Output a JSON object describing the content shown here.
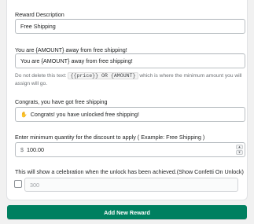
{
  "reward_description": {
    "label": "Reward Description",
    "value": "Free Shipping"
  },
  "away_message": {
    "label": "You are {AMOUNT} away from free shipping!",
    "value": "You are {AMOUNT} away from free shipping!",
    "help_prefix": "Do not delete this text: ",
    "help_code": "{{price}} OR {AMOUNT}",
    "help_suffix": " which is where the minimum amount you will assign will go."
  },
  "congrats_message": {
    "label": "Congrats, you have got free shipping",
    "icon": "party-popper-icon",
    "value": "Congrats! you have unlocked free shipping!"
  },
  "min_quantity": {
    "label": "Enter minimum quantity for the discount to apply ( Example: Free Shipping )",
    "prefix": "$",
    "value": "100.00"
  },
  "confetti": {
    "label": "This will show a celebration when the unlock has been achieved.(Show Confetti On Unlock)",
    "checked": false,
    "value": "300"
  },
  "add_button": {
    "label": "Add New Reward"
  },
  "colors": {
    "primary": "#008060",
    "border": "#babfc3",
    "help_text": "#6d7175"
  }
}
